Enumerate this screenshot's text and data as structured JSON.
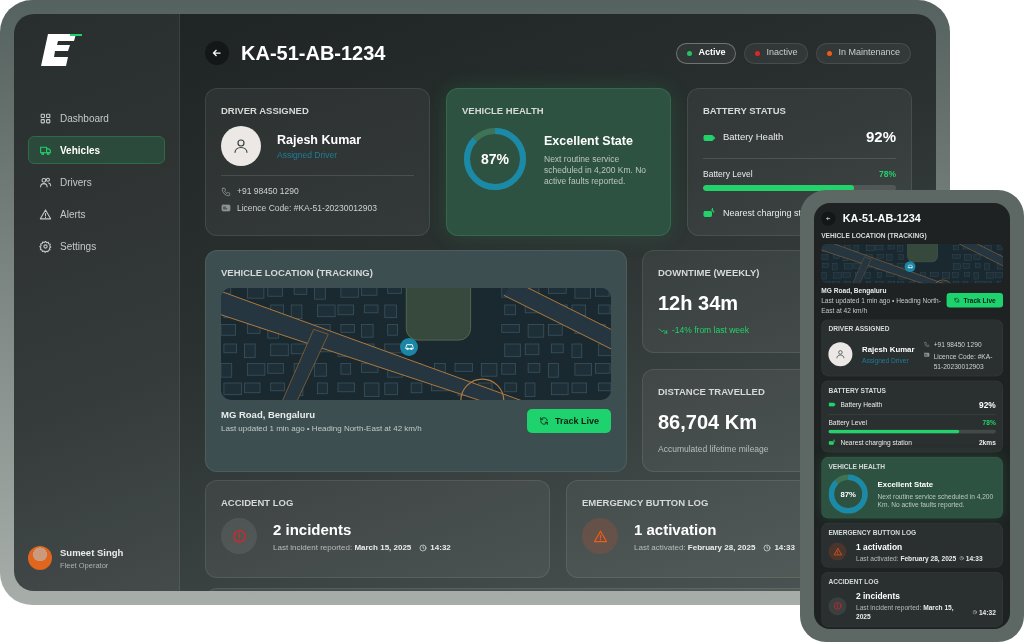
{
  "tablet": {
    "sidebar": {
      "items": [
        {
          "label": "Dashboard",
          "selected": false
        },
        {
          "label": "Vehicles",
          "selected": true
        },
        {
          "label": "Drivers",
          "selected": false
        },
        {
          "label": "Alerts",
          "selected": false
        },
        {
          "label": "Settings",
          "selected": false
        }
      ],
      "user": {
        "name": "Sumeet Singh",
        "role": "Fleet Operator"
      }
    },
    "header": {
      "title": "KA-51-AB-1234",
      "statuses": [
        {
          "label": "Active",
          "color": "#22c55e",
          "selected": true
        },
        {
          "label": "Inactive",
          "color": "#dc2626",
          "selected": false
        },
        {
          "label": "In Maintenance",
          "color": "#f05a1a",
          "selected": false
        }
      ]
    },
    "driver": {
      "heading": "DRIVER ASSIGNED",
      "name": "Rajesh Kumar",
      "role": "Assigned Driver",
      "phone": "+91 98450 1290",
      "licence": "Licence Code: #KA-51-20230012903"
    },
    "health": {
      "heading": "VEHICLE HEALTH",
      "level": 0.87,
      "reading": "87%",
      "state": "Excellent State",
      "note": "Next routine service scheduled in 4,200 Km. No active faults reported."
    },
    "battery": {
      "heading": "BATTERY STATUS",
      "health_label": "Battery Health",
      "health_value": "92%",
      "level_label": "Battery Level",
      "level_value": "78%",
      "level": 0.78,
      "station_label": "Nearest charging st"
    },
    "location": {
      "heading": "VEHICLE LOCATION (TRACKING)",
      "place": "MG Road, Bengaluru",
      "updated": "Last updated 1 min ago • Heading North-East at 42 km/h",
      "button": "Track Live"
    },
    "downtime": {
      "heading": "DOWNTIME (WEEKLY)",
      "value": "12h 34m",
      "trend": "-14% from last week"
    },
    "distance": {
      "heading": "DISTANCE TRAVELLED",
      "value": "86,704 Km",
      "note": "Accumulated lifetime mileage"
    },
    "accident": {
      "heading": "ACCIDENT LOG",
      "value": "2 incidents",
      "detail": "Last incident reported: **March 15, 2025**",
      "time": "14:32"
    },
    "emergency": {
      "heading": "EMERGENCY BUTTON LOG",
      "value": "1 activation",
      "detail": "Last activated: **February 28, 2025**",
      "time": "14:33"
    }
  },
  "phone": {
    "title": "KA-51-AB-1234",
    "location": {
      "heading": "VEHICLE LOCATION (TRACKING)",
      "place": "MG Road, Bengaluru",
      "updated": "Last updated 1 min ago • Heading North-East at 42 km/h",
      "button": "Track Live"
    },
    "driver": {
      "heading": "DRIVER ASSIGNED",
      "name": "Rajesh Kumar",
      "role": "Assigned Driver",
      "phone": "+91 98450 1290",
      "licence": "Licence Code: #KA-51-20230012903"
    },
    "battery": {
      "heading": "BATTERY STATUS",
      "health_label": "Battery Health",
      "health_value": "92%",
      "level_label": "Battery Level",
      "level_value": "78%",
      "level": 0.78,
      "station_label": "Nearest charging station",
      "station_value": "2kms"
    },
    "health": {
      "heading": "VEHICLE HEALTH",
      "level": 0.87,
      "reading": "87%",
      "state": "Excellent State",
      "note": "Next routine service scheduled in 4,200 Km. No active faults reported."
    },
    "emergency": {
      "heading": "EMERGENCY BUTTON LOG",
      "value": "1 activation",
      "detail": "Last activated: **February 28, 2025**",
      "time": "14:33"
    },
    "accident": {
      "heading": "ACCIDENT LOG",
      "value": "2 incidents",
      "detail": "Last incident reported: **March 15, 2025**",
      "time": "14:32"
    }
  }
}
